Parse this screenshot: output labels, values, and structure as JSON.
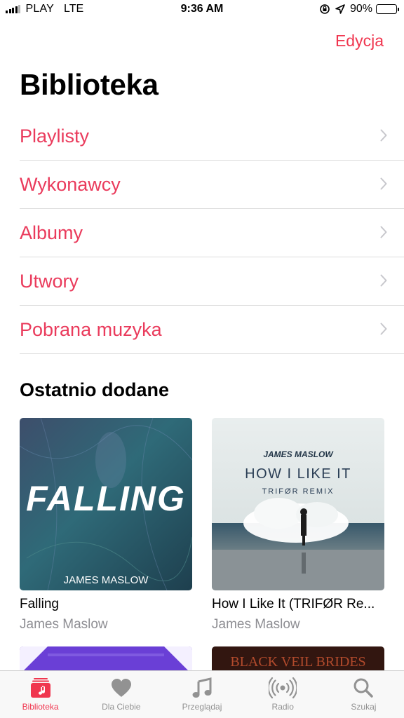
{
  "status_bar": {
    "carrier": "PLAY",
    "network": "LTE",
    "time": "9:36 AM",
    "battery": "90%",
    "battery_level": 0.9
  },
  "header": {
    "edit_label": "Edycja",
    "title": "Biblioteka"
  },
  "library": {
    "items": [
      {
        "label": "Playlisty"
      },
      {
        "label": "Wykonawcy"
      },
      {
        "label": "Albumy"
      },
      {
        "label": "Utwory"
      },
      {
        "label": "Pobrana muzyka"
      }
    ]
  },
  "recently_added": {
    "title": "Ostatnio dodane",
    "albums": [
      {
        "title": "Falling",
        "artist": "James Maslow",
        "art_title": "FALLING",
        "art_artist": "JAMES MASLOW"
      },
      {
        "title": "How I Like It (TRIFØR Re...",
        "artist": "James Maslow",
        "art_artist": "JAMES MASLOW",
        "art_title": "HOW I LIKE IT",
        "art_subtitle": "TRIFØR REMIX"
      }
    ],
    "peek_art_text": "BLACK VEIL BRIDES"
  },
  "tab_bar": {
    "tabs": [
      {
        "label": "Biblioteka",
        "icon": "library-icon",
        "active": true
      },
      {
        "label": "Dla Ciebie",
        "icon": "heart-icon",
        "active": false
      },
      {
        "label": "Przeglądaj",
        "icon": "music-note-icon",
        "active": false
      },
      {
        "label": "Radio",
        "icon": "radio-icon",
        "active": false
      },
      {
        "label": "Szukaj",
        "icon": "search-icon",
        "active": false
      }
    ]
  },
  "colors": {
    "accent": "#f0364f",
    "link": "#ea3b5c",
    "secondary_text": "#8e8e93",
    "tab_inactive": "#929292"
  }
}
